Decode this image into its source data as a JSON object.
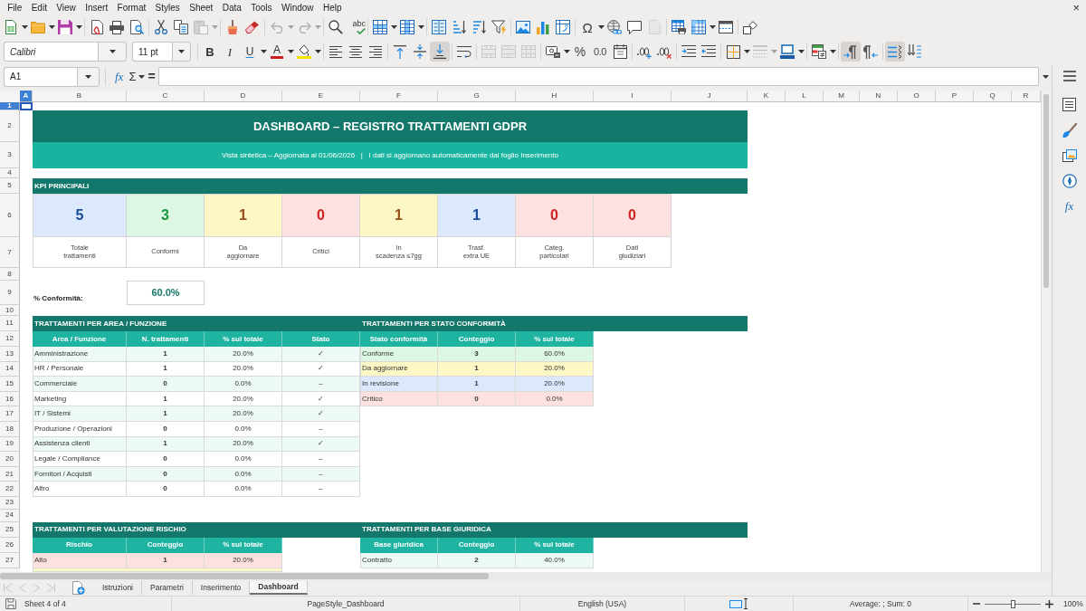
{
  "menu_bar": {
    "items": [
      "File",
      "Edit",
      "View",
      "Insert",
      "Format",
      "Styles",
      "Sheet",
      "Data",
      "Tools",
      "Window",
      "Help"
    ],
    "close": "×"
  },
  "standard_toolbar": {
    "spelling": "abc",
    "special_character": "Ω",
    "paste": {
      "disabled": true
    },
    "undo": {
      "disabled": true
    },
    "redo": {
      "disabled": true
    },
    "header_footer": {
      "disabled": true
    }
  },
  "formatting_toolbar": {
    "font_name": "Calibri",
    "font_size": "11 pt",
    "bold": "B",
    "italic": "I",
    "underline": "U",
    "font_color": "A",
    "percent": "%",
    "decimal": "0.0",
    "merge_and_center": {
      "disabled": true
    },
    "merge_cells": {
      "disabled": true
    },
    "unmerge_cells": {
      "disabled": true
    },
    "border_style": {
      "disabled": true
    },
    "vertical_alignment": [
      {
        "selected": false
      },
      {
        "selected": false
      },
      {
        "selected": true
      }
    ],
    "paragraph_direction": [
      {
        "selected": true
      },
      {
        "selected": false
      }
    ],
    "text_orientation": [
      {
        "selected": true
      },
      {
        "selected": false
      }
    ]
  },
  "formula_bar": {
    "name_box": "A1",
    "function_wizard": "fx",
    "sum": "Σ",
    "formula": "="
  },
  "sidebar": {
    "functions": "fx"
  },
  "column_headers": [
    {
      "label": "A",
      "selected": true
    },
    {
      "label": "B",
      "selected": false
    },
    {
      "label": "C",
      "selected": false
    },
    {
      "label": "D",
      "selected": false
    },
    {
      "label": "E",
      "selected": false
    },
    {
      "label": "F",
      "selected": false
    },
    {
      "label": "G",
      "selected": false
    },
    {
      "label": "H",
      "selected": false
    },
    {
      "label": "I",
      "selected": false
    },
    {
      "label": "J",
      "selected": false
    },
    {
      "label": "K",
      "selected": false
    },
    {
      "label": "L",
      "selected": false
    },
    {
      "label": "M",
      "selected": false
    },
    {
      "label": "N",
      "selected": false
    },
    {
      "label": "O",
      "selected": false
    },
    {
      "label": "P",
      "selected": false
    },
    {
      "label": "Q",
      "selected": false
    },
    {
      "label": "R",
      "selected": false
    }
  ],
  "row_headers": [
    {
      "label": "1",
      "selected": true
    },
    {
      "label": "2",
      "selected": false
    },
    {
      "label": "3",
      "selected": false
    },
    {
      "label": "4",
      "selected": false
    },
    {
      "label": "5",
      "selected": false
    },
    {
      "label": "6",
      "selected": false
    },
    {
      "label": "7",
      "selected": false
    },
    {
      "label": "8",
      "selected": false
    },
    {
      "label": "9",
      "selected": false
    },
    {
      "label": "10",
      "selected": false
    },
    {
      "label": "11",
      "selected": false
    },
    {
      "label": "12",
      "selected": false
    },
    {
      "label": "13",
      "selected": false
    },
    {
      "label": "14",
      "selected": false
    },
    {
      "label": "15",
      "selected": false
    },
    {
      "label": "16",
      "selected": false
    },
    {
      "label": "17",
      "selected": false
    },
    {
      "label": "18",
      "selected": false
    },
    {
      "label": "19",
      "selected": false
    },
    {
      "label": "20",
      "selected": false
    },
    {
      "label": "21",
      "selected": false
    },
    {
      "label": "22",
      "selected": false
    },
    {
      "label": "23",
      "selected": false
    },
    {
      "label": "24",
      "selected": false
    },
    {
      "label": "25",
      "selected": false
    },
    {
      "label": "26",
      "selected": false
    },
    {
      "label": "27",
      "selected": false
    }
  ],
  "sheet": {
    "title": "DASHBOARD – REGISTRO TRATTAMENTI GDPR",
    "subtitle": "Vista sintetica – Aggiornata al 01/06/2026   |   I dati si aggiornano automaticamente dal foglio Inserimento",
    "kpi_title": "KPI PRINCIPALI",
    "kpis": [
      {
        "value": "5",
        "label": "Totale\ntrattamenti",
        "color": "#dce9fc"
      },
      {
        "value": "3",
        "label": "Conformi",
        "color": "#dcf8e4"
      },
      {
        "value": "1",
        "label": "Da\naggiornare",
        "color": "#fcf7c4"
      },
      {
        "value": "0",
        "label": "Critici",
        "color": "#fde0e0"
      },
      {
        "value": "1",
        "label": "In\nscadenza ≤7gg",
        "color": "#fcf7c4"
      },
      {
        "value": "1",
        "label": "Trasf.\nextra UE",
        "color": "#dce9fc"
      },
      {
        "value": "0",
        "label": "Categ.\nparticolari",
        "color": "#fde0e0"
      },
      {
        "value": "0",
        "label": "Dati\ngiudiziari",
        "color": "#fde0e0"
      }
    ],
    "conformity": {
      "label": "% Conformità:",
      "value": "60.0%"
    },
    "tables": [
      {
        "title": "TRATTAMENTI PER AREA / FUNZIONE",
        "columns": [
          "Area / Funzione",
          "N. trattamenti",
          "% sul totale",
          "Stato"
        ],
        "rows": [
          {
            "cells": [
              "Amministrazione",
              "1",
              "20.0%",
              "✓"
            ]
          },
          {
            "cells": [
              "HR / Personale",
              "1",
              "20.0%",
              "✓"
            ]
          },
          {
            "cells": [
              "Commerciale",
              "0",
              "0.0%",
              "–"
            ]
          },
          {
            "cells": [
              "Marketing",
              "1",
              "20.0%",
              "✓"
            ]
          },
          {
            "cells": [
              "IT / Sistemi",
              "1",
              "20.0%",
              "✓"
            ]
          },
          {
            "cells": [
              "Produzione / Operazioni",
              "0",
              "0.0%",
              "–"
            ]
          },
          {
            "cells": [
              "Assistenza clienti",
              "1",
              "20.0%",
              "✓"
            ]
          },
          {
            "cells": [
              "Legale / Compliance",
              "0",
              "0.0%",
              "–"
            ]
          },
          {
            "cells": [
              "Fornitori / Acquisti",
              "0",
              "0.0%",
              "–"
            ]
          },
          {
            "cells": [
              "Altro",
              "0",
              "0.0%",
              "–"
            ]
          }
        ]
      },
      {
        "title": "TRATTAMENTI PER STATO CONFORMITÀ",
        "columns": [
          "Stato conformità",
          "Conteggio",
          "% sul totale"
        ],
        "rows": [
          {
            "cells": [
              "Conforme",
              "3",
              "60.0%"
            ],
            "color": "#dcf8e4"
          },
          {
            "cells": [
              "Da aggiornare",
              "1",
              "20.0%"
            ],
            "color": "#fcf7c4"
          },
          {
            "cells": [
              "In revisione",
              "1",
              "20.0%"
            ],
            "color": "#dce9fc"
          },
          {
            "cells": [
              "Critico",
              "0",
              "0.0%"
            ],
            "color": "#fde0e0"
          }
        ]
      },
      {
        "title": "TRATTAMENTI PER VALUTAZIONE RISCHIO",
        "columns": [
          "Rischio",
          "Conteggio",
          "% sul totale"
        ],
        "rows": [
          {
            "cells": [
              "Alto",
              "1",
              "20.0%"
            ],
            "color": "#fde0e0"
          },
          {
            "color": "#fcf7c4"
          }
        ]
      },
      {
        "title": "TRATTAMENTI PER BASE GIURIDICA",
        "columns": [
          "Base giuridica",
          "Conteggio",
          "% sul totale"
        ],
        "rows": [
          {
            "cells": [
              "Contratto",
              "2",
              "40.0%"
            ]
          }
        ]
      }
    ]
  },
  "sheet_navigation": {
    "disabled": true
  },
  "sheet_tabs": [
    {
      "label": "Istruzioni",
      "selected": false
    },
    {
      "label": "Parametri",
      "selected": false
    },
    {
      "label": "Inserimento",
      "selected": false
    },
    {
      "label": "Dashboard",
      "selected": true
    }
  ],
  "status_bar": {
    "sheet": "Sheet 4 of 4",
    "page_style": "PageStyle_Dashboard",
    "language": "English (USA)",
    "summary": "Average: ; Sum: 0",
    "zoom": {
      "level": 0.5,
      "reading": "100%"
    }
  }
}
